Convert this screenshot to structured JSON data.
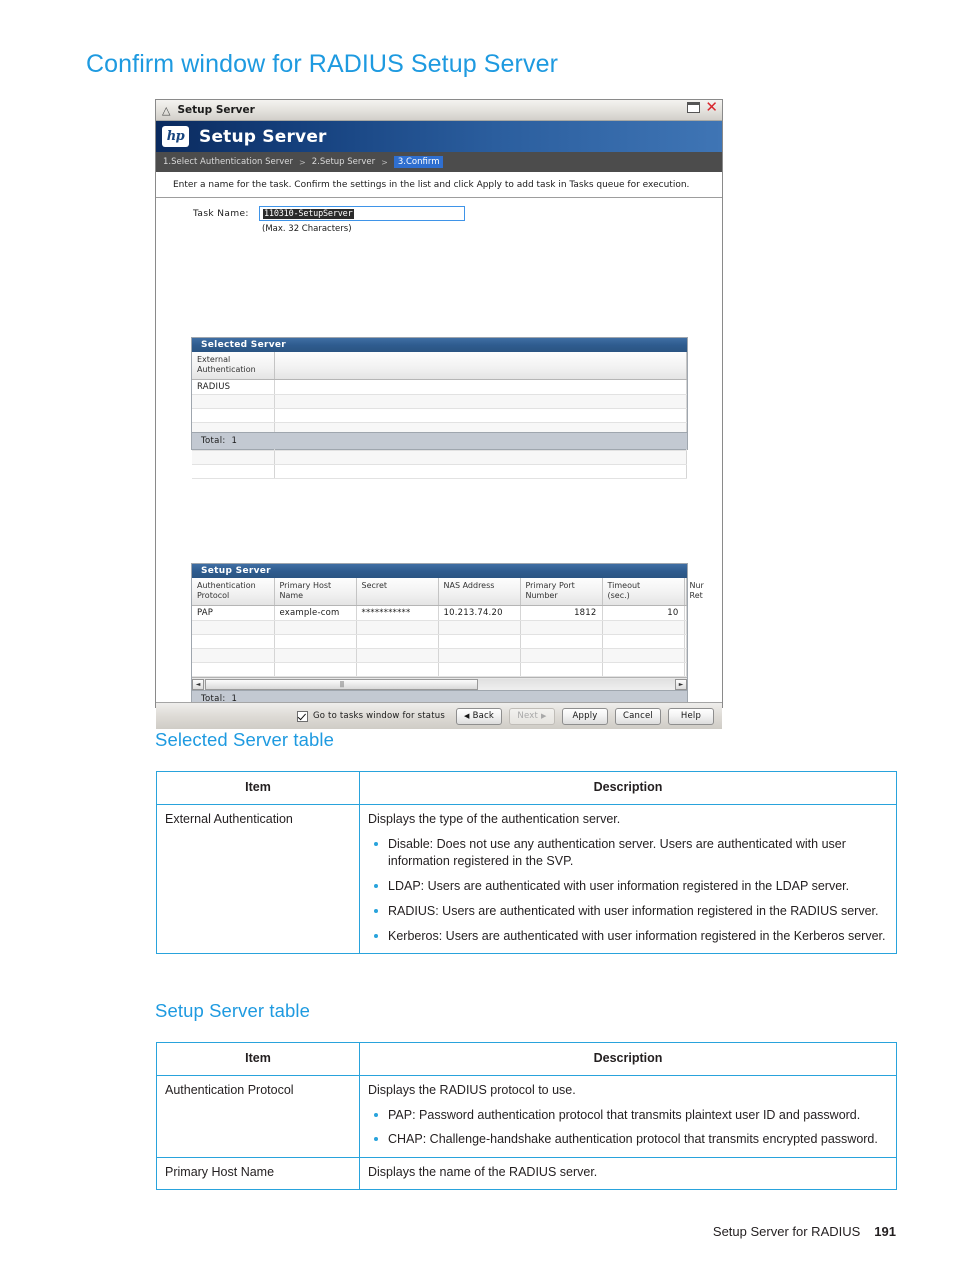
{
  "page": {
    "title": "Confirm window for RADIUS Setup Server",
    "footer_text": "Setup Server for RADIUS",
    "page_number": "191",
    "accent_color": "#29a3dc",
    "heading_color": "#1e9ae0"
  },
  "dialog": {
    "titlebar": {
      "title": "Setup Server",
      "chevron_icon": "chevron-up-icon",
      "maximize_icon": "maximize-icon",
      "close_icon": "close-icon"
    },
    "banner": {
      "logo_text": "hp",
      "title": "Setup Server"
    },
    "breadcrumb": {
      "separator": ">",
      "steps": [
        {
          "label": "1.Select Authentication Server",
          "active": false
        },
        {
          "label": "2.Setup Server",
          "active": false
        },
        {
          "label": "3.Confirm",
          "active": true
        }
      ]
    },
    "instruction": "Enter a name for the task. Confirm the settings in the list and click Apply to add task in Tasks queue for execution.",
    "task_name": {
      "label": "Task Name:",
      "value": "110310-SetupServer",
      "hint": "(Max. 32 Characters)"
    },
    "selected_server_panel": {
      "title": "Selected Server",
      "columns": [
        "External Authentication"
      ],
      "rows": [
        [
          "RADIUS"
        ]
      ],
      "empty_rows": 6,
      "total_label": "Total:",
      "total_value": "1"
    },
    "setup_server_panel": {
      "title": "Setup Server",
      "columns": [
        "Authentication Protocol",
        "Primary Host Name",
        "Secret",
        "NAS Address",
        "Primary Port Number",
        "Timeout (sec.)",
        "Number of Retries"
      ],
      "columns_display": [
        "Authentication\nProtocol",
        "Primary Host\nName",
        "Secret",
        "NAS Address",
        "Primary Port\nNumber",
        "Timeout\n(sec.)",
        "Nur\nRet"
      ],
      "rows": [
        {
          "authentication_protocol": "PAP",
          "primary_host_name": "example-com",
          "secret": "***********",
          "nas_address": "10.213.74.20",
          "primary_port_number": "1812",
          "timeout": "10",
          "number_of_retries": ""
        }
      ],
      "empty_rows": 5,
      "total_label": "Total:",
      "total_value": "1",
      "scrollbar": {
        "left_arrow": "◄",
        "right_arrow": "►",
        "grip": "||||"
      }
    },
    "buttons": {
      "checkbox_label": "Go to tasks window for status",
      "checkbox_checked": true,
      "back": "Back",
      "next": "Next",
      "next_disabled": true,
      "apply": "Apply",
      "cancel": "Cancel",
      "help": "Help",
      "back_arrow": "◀",
      "next_arrow": "▶"
    }
  },
  "selected_server_section": {
    "heading": "Selected Server table",
    "header_item": "Item",
    "header_description": "Description",
    "row_item": "External Authentication",
    "row_intro": "Displays the type of the authentication server.",
    "bullets": [
      "Disable: Does not use any authentication server. Users are authenticated with user information registered in the SVP.",
      "LDAP: Users are authenticated with user information registered in the LDAP server.",
      "RADIUS: Users are authenticated with user information registered in the RADIUS server.",
      "Kerberos: Users are authenticated with user information registered in the Kerberos server."
    ]
  },
  "setup_server_section": {
    "heading": "Setup Server table",
    "header_item": "Item",
    "header_description": "Description",
    "row1_item": "Authentication Protocol",
    "row1_intro": "Displays the RADIUS protocol to use.",
    "row1_bullets": [
      "PAP: Password authentication protocol that transmits plaintext user ID and password.",
      "CHAP: Challenge-handshake authentication protocol that transmits encrypted password."
    ],
    "row2_item": "Primary Host Name",
    "row2_description": "Displays the name of the RADIUS server."
  }
}
